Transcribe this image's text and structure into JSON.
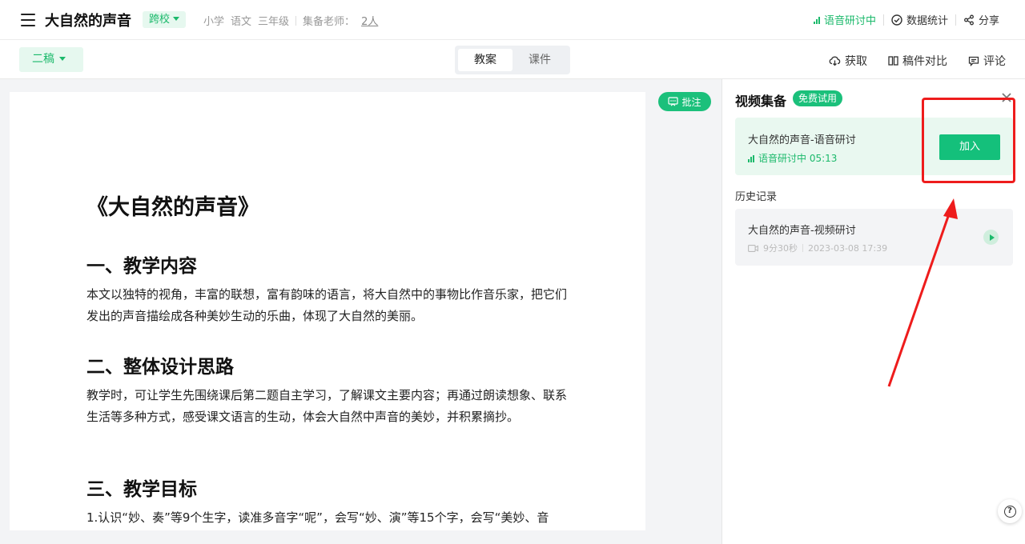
{
  "header": {
    "title": "大自然的声音",
    "scope_tag": "跨校",
    "meta": [
      "小学",
      "语文",
      "三年级"
    ],
    "teachers_label": "集备老师：",
    "teachers_count": "2人",
    "live_status": "语音研讨中",
    "stats_label": "数据统计",
    "share_label": "分享"
  },
  "toolbar": {
    "draft_label": "二稿",
    "tabs": [
      {
        "label": "教案",
        "active": true
      },
      {
        "label": "课件",
        "active": false
      }
    ],
    "fetch_label": "获取",
    "compare_label": "稿件对比",
    "comment_label": "评论",
    "annotate_label": "批注"
  },
  "document": {
    "title": "《大自然的声音》",
    "sections": [
      {
        "heading": "一、教学内容",
        "body": "本文以独特的视角，丰富的联想，富有韵味的语言，将大自然中的事物比作音乐家，把它们发出的声音描绘成各种美妙生动的乐曲，体现了大自然的美丽。"
      },
      {
        "heading": "二、整体设计思路",
        "body": "教学时，可让学生先围绕课后第二题自主学习，了解课文主要内容；再通过朗读想象、联系生活等多种方式，感受课文语言的生动，体会大自然中声音的美妙，并积累摘抄。"
      },
      {
        "heading": "三、教学目标",
        "body": "1.认识“妙、奏”等9个生字，读准多音字“呢”，会写“妙、演”等15个字，会写“美妙、音"
      }
    ]
  },
  "panel": {
    "title": "视频集备",
    "free_tag": "免费试用",
    "live_card": {
      "name": "大自然的声音-语音研讨",
      "status": "语音研讨中 05:13",
      "join_label": "加入"
    },
    "history_label": "历史记录",
    "history": [
      {
        "name": "大自然的声音-视频研讨",
        "duration": "9分30秒",
        "date": "2023-03-08 17:39"
      }
    ]
  },
  "colors": {
    "brand_green": "#1bb96b",
    "annotation_red": "#ee1c1c"
  }
}
